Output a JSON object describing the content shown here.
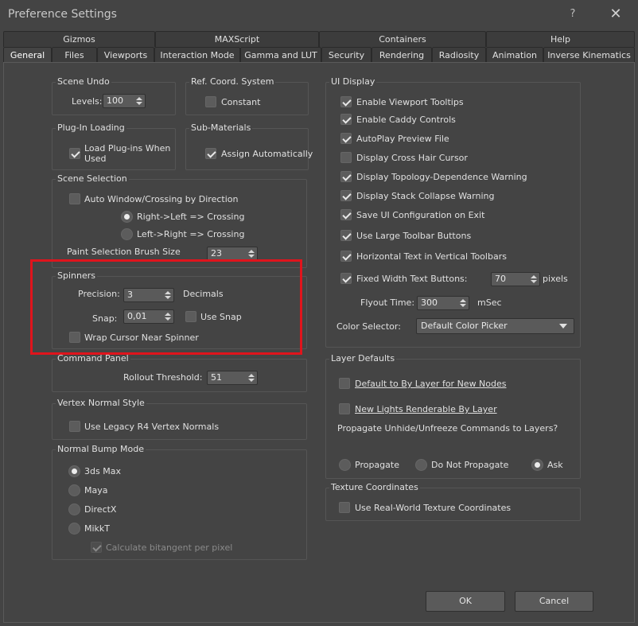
{
  "window": {
    "title": "Preference Settings",
    "help": "?",
    "close": "✕"
  },
  "tabs_top": [
    "Gizmos",
    "MAXScript",
    "Containers",
    "Help"
  ],
  "tabs_bottom": [
    "General",
    "Files",
    "Viewports",
    "Interaction Mode",
    "Gamma and LUT",
    "Security",
    "Rendering",
    "Radiosity",
    "Animation",
    "Inverse Kinematics"
  ],
  "scene_undo": {
    "title": "Scene Undo",
    "levels_label": "Levels:",
    "levels_value": "100"
  },
  "ref_coord": {
    "title": "Ref. Coord. System",
    "constant_label": "Constant",
    "constant_checked": false
  },
  "plugin_loading": {
    "title": "Plug-In Loading",
    "load_label_1": "Load Plug-ins When",
    "load_label_2": "Used",
    "load_checked": true
  },
  "sub_materials": {
    "title": "Sub-Materials",
    "assign_label": "Assign Automatically",
    "assign_checked": true
  },
  "scene_selection": {
    "title": "Scene Selection",
    "auto_window_label": "Auto Window/Crossing by Direction",
    "right_left_label": "Right->Left => Crossing",
    "left_right_label": "Left->Right => Crossing",
    "brush_label": "Paint Selection Brush Size",
    "brush_value": "23"
  },
  "spinners": {
    "title": "Spinners",
    "precision_label": "Precision:",
    "precision_value": "3",
    "decimals_label": "Decimals",
    "snap_label": "Snap:",
    "snap_value": "0,01",
    "use_snap_label": "Use Snap",
    "wrap_label": "Wrap Cursor Near Spinner"
  },
  "command_panel": {
    "title": "Command Panel",
    "rollout_label": "Rollout Threshold:",
    "rollout_value": "51"
  },
  "vertex_normal": {
    "title": "Vertex Normal Style",
    "legacy_label": "Use Legacy R4 Vertex Normals"
  },
  "normal_bump": {
    "title": "Normal Bump Mode",
    "options": [
      "3ds Max",
      "Maya",
      "DirectX",
      "MikkT"
    ],
    "selected": "3ds Max",
    "bitangent_label": "Calculate bitangent per pixel"
  },
  "ui_display": {
    "title": "UI Display",
    "items": [
      {
        "label": "Enable Viewport Tooltips",
        "checked": true
      },
      {
        "label": "Enable Caddy Controls",
        "checked": true
      },
      {
        "label": "AutoPlay Preview File",
        "checked": true
      },
      {
        "label": "Display Cross Hair Cursor",
        "checked": false
      },
      {
        "label": "Display Topology-Dependence Warning",
        "checked": true
      },
      {
        "label": "Display Stack Collapse Warning",
        "checked": true
      },
      {
        "label": "Save UI Configuration on Exit",
        "checked": true
      },
      {
        "label": "Use Large Toolbar Buttons",
        "checked": true
      },
      {
        "label": "Horizontal Text in Vertical Toolbars",
        "checked": true
      },
      {
        "label": "Fixed Width Text Buttons:",
        "checked": true
      }
    ],
    "fixed_width_value": "70",
    "pixels_label": "pixels",
    "flyout_label": "Flyout Time:",
    "flyout_value": "300",
    "msec_label": "mSec",
    "color_selector_label": "Color Selector:",
    "color_selector_value": "Default Color Picker"
  },
  "layer_defaults": {
    "title": "Layer Defaults",
    "by_layer_label": "Default to By Layer for New Nodes",
    "new_lights_label": "New Lights Renderable By Layer",
    "propagate_question": "Propagate Unhide/Unfreeze Commands to Layers?",
    "propagate_label": "Propagate",
    "do_not_label": "Do Not Propagate",
    "ask_label": "Ask",
    "selected": "Ask"
  },
  "texture_coords": {
    "title": "Texture Coordinates",
    "real_world_label": "Use Real-World Texture Coordinates"
  },
  "buttons": {
    "ok": "OK",
    "cancel": "Cancel"
  },
  "colors": {
    "background": "#444444",
    "highlight": "#e0141c"
  }
}
